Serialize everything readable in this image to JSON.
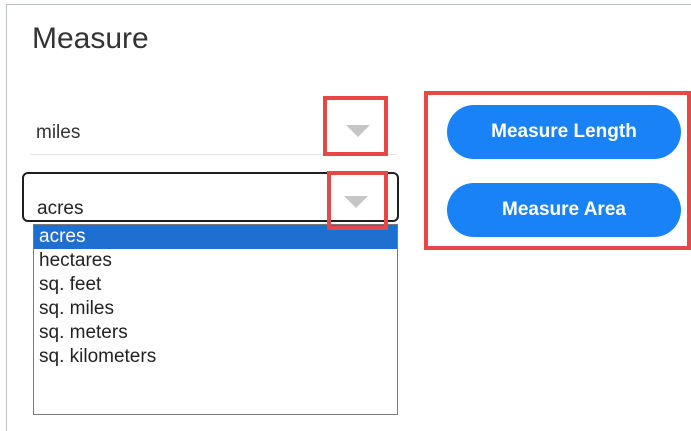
{
  "panel": {
    "title": "Measure"
  },
  "length_unit": {
    "value": "miles",
    "icon": "chevron-down-icon"
  },
  "area_unit": {
    "value": "acres",
    "icon": "chevron-down-icon",
    "options": [
      "acres",
      "hectares",
      "sq. feet",
      "sq. miles",
      "sq. meters",
      "sq. kilometers"
    ],
    "selected_index": 0
  },
  "buttons": {
    "measure_length": "Measure Length",
    "measure_area": "Measure Area"
  },
  "colors": {
    "accent": "#1a82f7",
    "highlight_box": "#e8474a",
    "selected_option": "#1e6fd0"
  }
}
